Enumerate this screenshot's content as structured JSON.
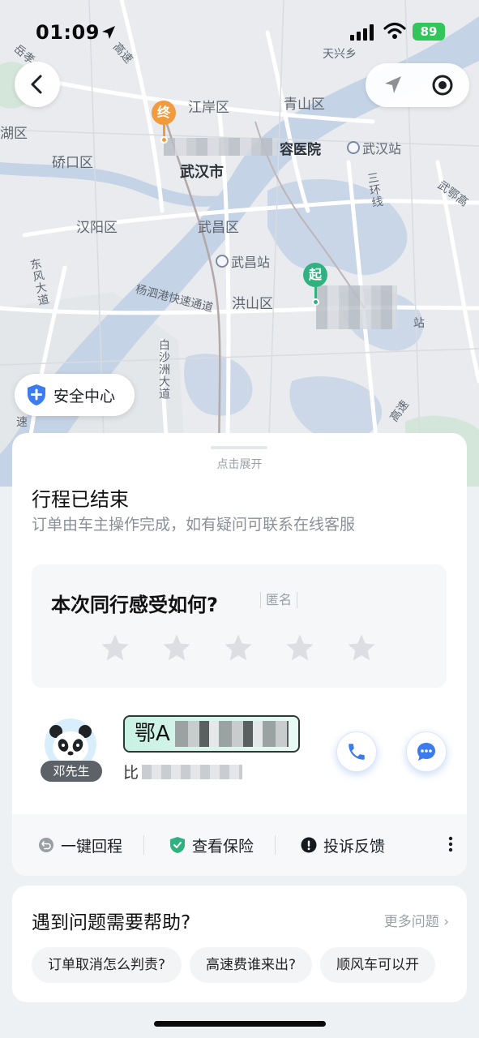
{
  "status_bar": {
    "time": "01:09",
    "battery": "89"
  },
  "map": {
    "labels": {
      "jianghan": "江岸区",
      "qingshan": "青山区",
      "hukou": "湖区",
      "qiaokou": "硚口区",
      "wuhan": "武汉市",
      "hanyang": "汉阳区",
      "wuchang": "武昌区",
      "hongshan": "洪山区",
      "tianxing": "天兴乡",
      "hospital": "容医院",
      "dongfeng": "东风大道",
      "yangsi": "杨泗港快速通道",
      "baisha": "白沙洲大道",
      "wue": "武鄂高",
      "sanhuan": "三环线",
      "gao": "高速",
      "su": "速",
      "zhan": "站",
      "gaosu_tl": "高速",
      "bao": "岳孝"
    },
    "stations": {
      "wuhan_station": "武汉站",
      "wuchang_station": "武昌站"
    },
    "pins": {
      "end": "终",
      "start": "起"
    }
  },
  "safety_center": "安全中心",
  "sheet": {
    "expand_hint": "点击展开",
    "title": "行程已结束",
    "subtitle": "订单由车主操作完成，如有疑问可联系在线客服",
    "rating_question": "本次同行感受如何?",
    "anonymous": "匿名",
    "driver_name": "邓先生",
    "plate_prefix": "鄂A",
    "car_prefix": "比",
    "actions": [
      {
        "label": "一键回程"
      },
      {
        "label": "查看保险"
      },
      {
        "label": "投诉反馈"
      }
    ]
  },
  "help": {
    "title": "遇到问题需要帮助?",
    "more": "更多问题",
    "chips": [
      "订单取消怎么判责?",
      "高速费谁来出?",
      "顺风车可以开"
    ]
  }
}
